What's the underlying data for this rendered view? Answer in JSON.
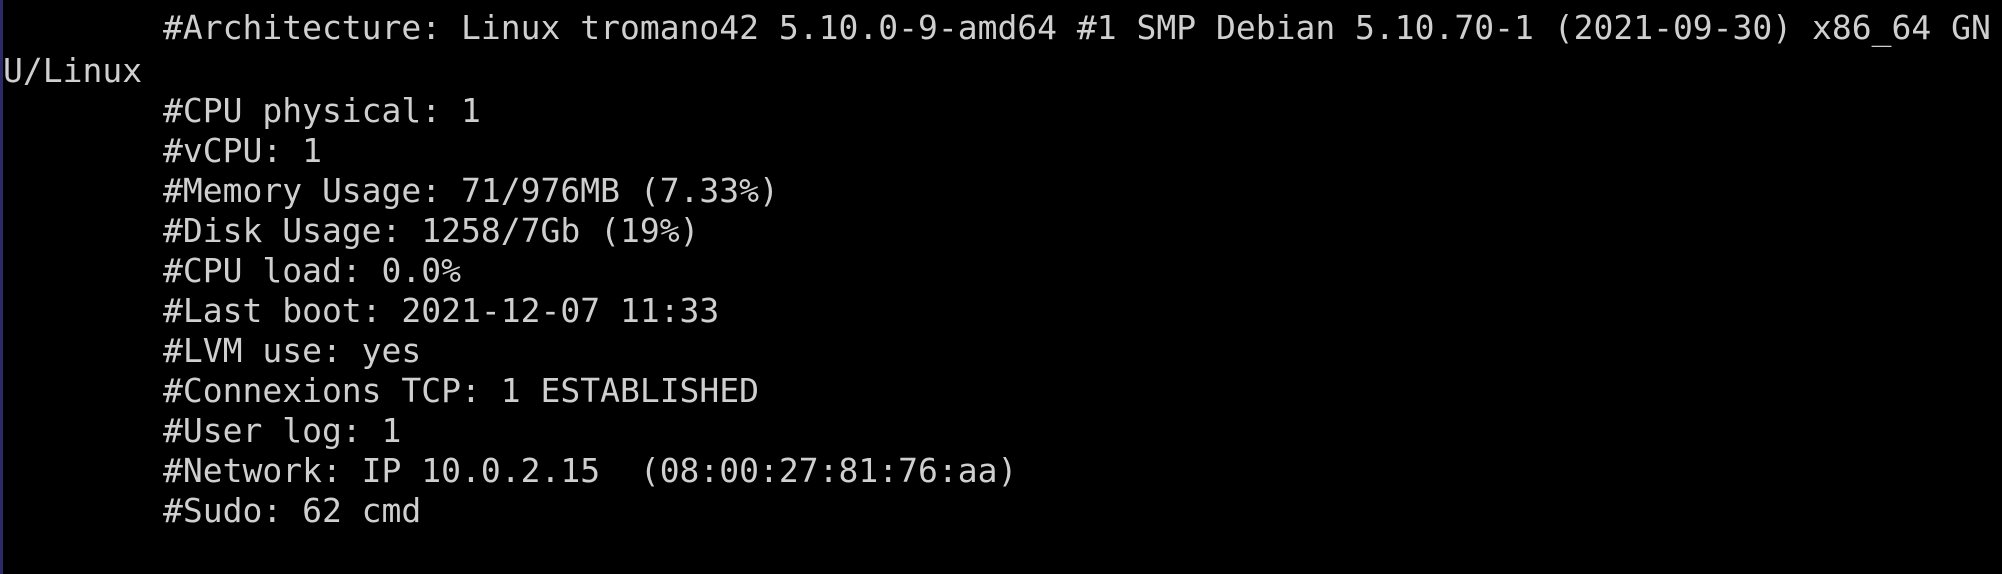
{
  "terminal": {
    "lines": [
      "#Architecture: Linux tromano42 5.10.0-9-amd64 #1 SMP Debian 5.10.70-1 (2021-09-30) x86_64 GN",
      "U/Linux",
      "#CPU physical: 1",
      "#vCPU: 1",
      "#Memory Usage: 71/976MB (7.33%)",
      "#Disk Usage: 1258/7Gb (19%)",
      "#CPU load: 0.0%",
      "#Last boot: 2021-12-07 11:33",
      "#LVM use: yes",
      "#Connexions TCP: 1 ESTABLISHED",
      "#User log: 1",
      "#Network: IP 10.0.2.15  (08:00:27:81:76:aa)",
      "#Sudo: 62 cmd"
    ]
  },
  "colors": {
    "background": "#000000",
    "text": "#cfcfcf"
  }
}
